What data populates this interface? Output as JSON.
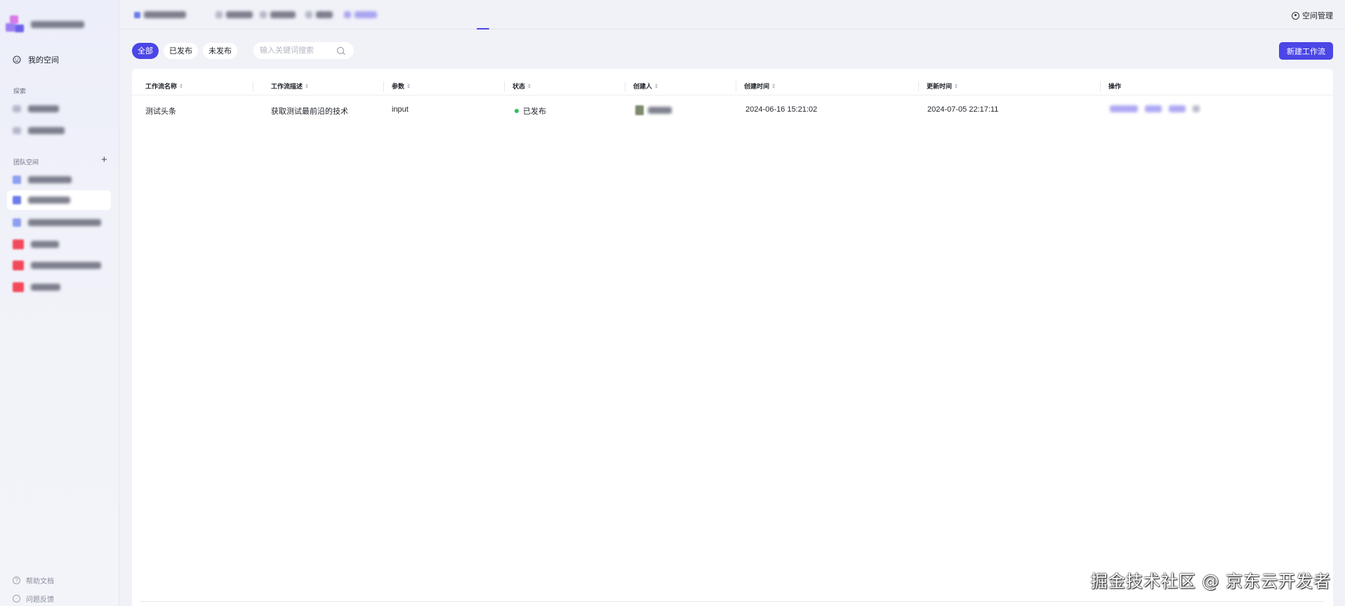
{
  "sidebar": {
    "my_space": "我的空间",
    "explore_label": "探索",
    "team_space_label": "团队空间",
    "help_doc": "帮助文档",
    "feedback": "问题反馈"
  },
  "topbar": {
    "space_management": "空间管理"
  },
  "filters": {
    "all": "全部",
    "published": "已发布",
    "unpublished": "未发布",
    "search_placeholder": "输入关键词搜索",
    "new_workflow": "新建工作流"
  },
  "table": {
    "headers": {
      "name": "工作流名称",
      "description": "工作流描述",
      "params": "参数",
      "status": "状态",
      "creator": "创建人",
      "created_at": "创建时间",
      "updated_at": "更新时间",
      "actions": "操作"
    },
    "rows": [
      {
        "name": "测试头条",
        "description": "获取测试最前沿的技术",
        "params": "input",
        "status": "已发布",
        "created_at": "2024-06-16 15:21:02",
        "updated_at": "2024-07-05 22:17:11"
      }
    ]
  },
  "watermark": "掘金技术社区 @ 京东云开发者",
  "colors": {
    "accent": "#4b46e6",
    "status_published": "#2fbd58"
  }
}
